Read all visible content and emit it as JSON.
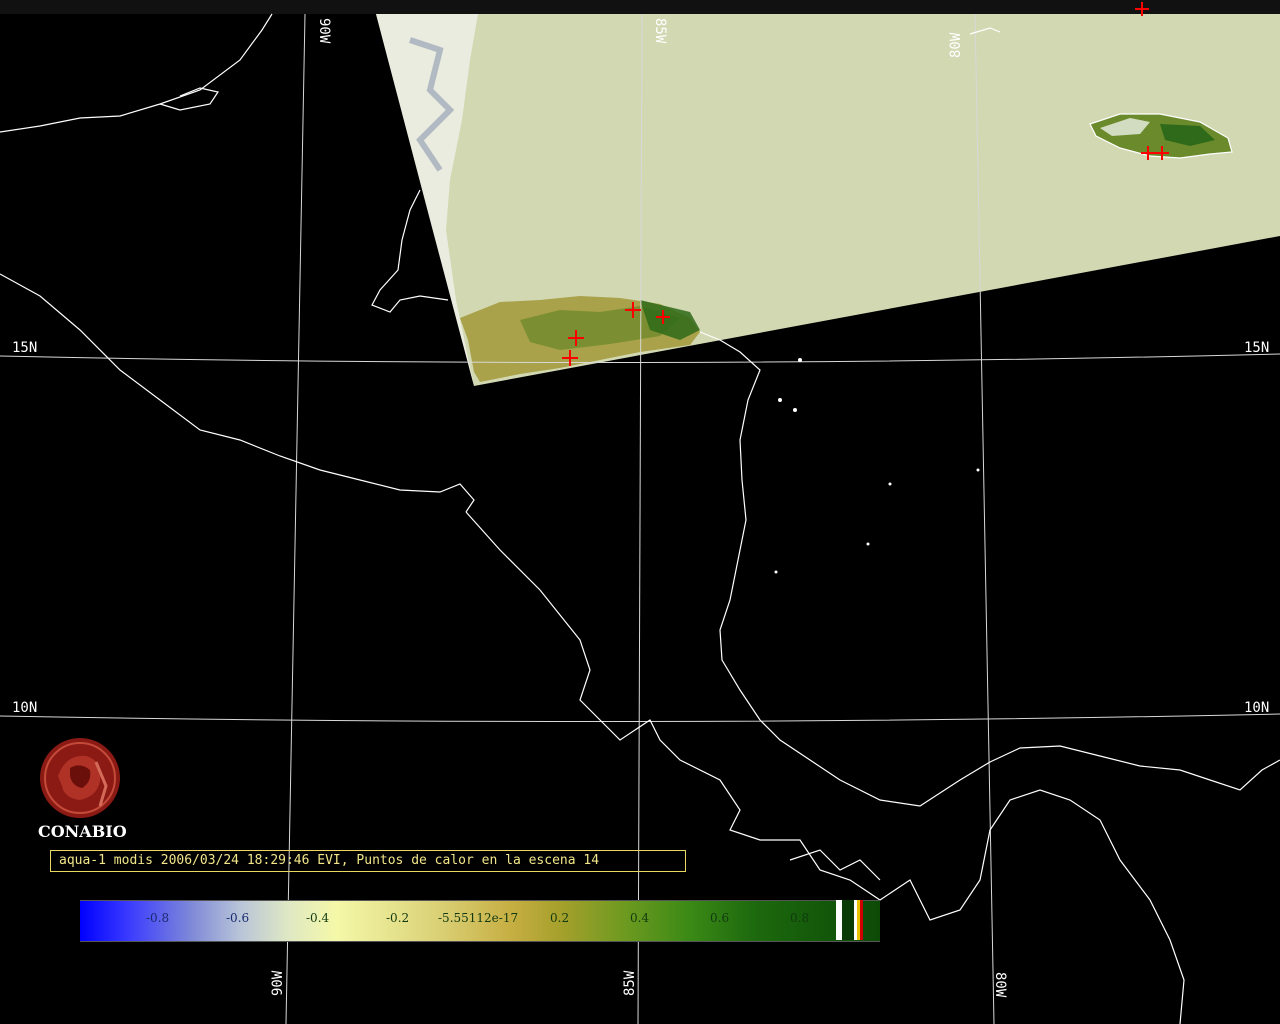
{
  "caption": "aqua-1 modis 2006/03/24 18:29:46 EVI, Puntos de calor en la escena 14",
  "logo_text": "CONABIO",
  "logo_icon": "conabio-seal-icon",
  "graticule": {
    "lat_left": [
      "15N",
      "10N"
    ],
    "lat_right": [
      "15N",
      "10N"
    ],
    "lon_top": [
      "90W",
      "85W",
      "80W"
    ],
    "lon_bottom": [
      "90W",
      "85W",
      "80W"
    ]
  },
  "colorbar": {
    "labels": [
      "-0.8",
      "-0.6",
      "-0.4",
      "-0.2",
      "-5.55112e-17",
      "0.2",
      "0.4",
      "0.6",
      "0.8"
    ],
    "colors": {
      "low": "#0000ff",
      "mid": "#f4f8a8",
      "high": "#0d4a07"
    }
  },
  "colors": {
    "swath": "#d2d8b2",
    "coast": "#ffffff",
    "hotspot": "#ff0000",
    "caption": "#f2e68a"
  }
}
